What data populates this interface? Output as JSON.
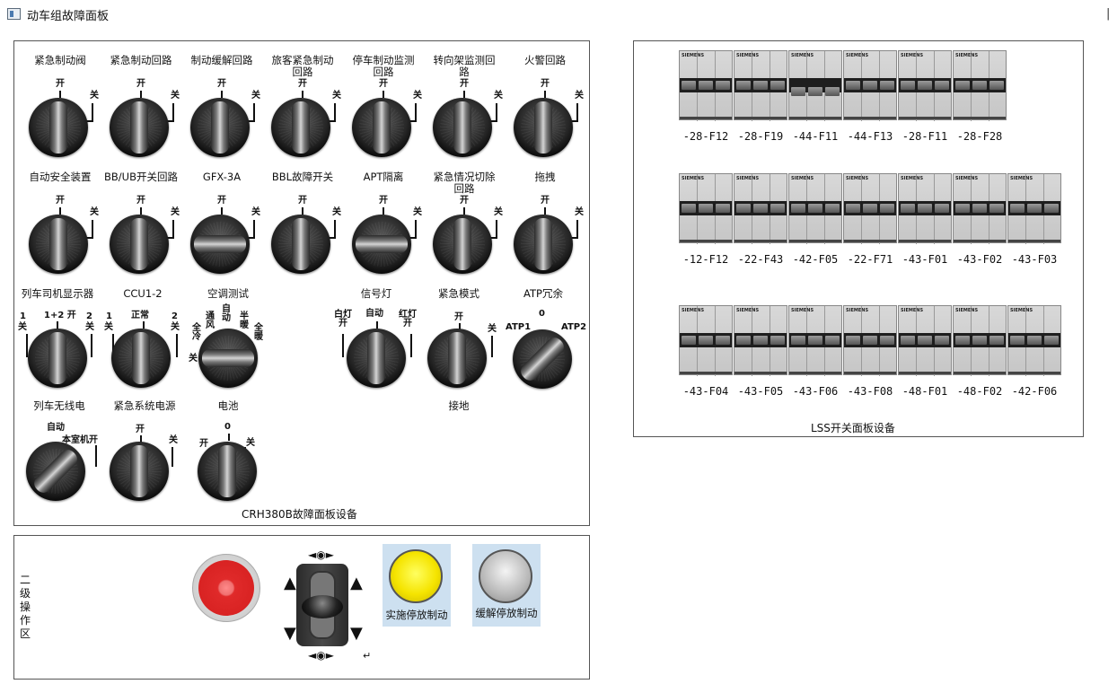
{
  "window": {
    "title": "动车组故障面板",
    "close_glyph": "|"
  },
  "crh_panel": {
    "caption": "CRH380B故障面板设备",
    "rows": [
      [
        {
          "label": "紧急制动阀",
          "open": "开",
          "close": "关"
        },
        {
          "label": "紧急制动回路",
          "open": "开",
          "close": "关"
        },
        {
          "label": "制动缓解回路",
          "open": "开",
          "close": "关"
        },
        {
          "label": "旅客紧急制动\n回路",
          "open": "开",
          "close": "关"
        },
        {
          "label": "停车制动监测\n回路",
          "open": "开",
          "close": "关"
        },
        {
          "label": "转向架监测回\n路",
          "open": "开",
          "close": "关"
        },
        {
          "label": "火警回路",
          "open": "开",
          "close": "关"
        }
      ],
      [
        {
          "label": "自动安全装置",
          "open": "开",
          "close": "关"
        },
        {
          "label": "BB/UB开关回路",
          "open": "开",
          "close": "关"
        },
        {
          "label": "GFX-3A",
          "open": "开",
          "close": "关"
        },
        {
          "label": "BBL故障开关",
          "open": "开",
          "close": "关"
        },
        {
          "label": "APT隔离",
          "open": "开",
          "close": "关"
        },
        {
          "label": "紧急情况切除\n回路",
          "open": "开",
          "close": "关"
        },
        {
          "label": "拖拽",
          "open": "开",
          "close": "关"
        }
      ]
    ],
    "row3": {
      "driver_display": {
        "label": "列车司机显示器",
        "pos1_num": "1",
        "pos1": "关",
        "pos2": "1+2 开",
        "pos3_num": "2",
        "pos3": "关"
      },
      "ccu": {
        "label": "CCU1-2",
        "pos1_num": "1",
        "pos1": "关",
        "pos2": "正常",
        "pos3_num": "2",
        "pos3": "关"
      },
      "ac_test": {
        "label": "空调测试",
        "off": "关",
        "full_cool": "全\n冷",
        "vent": "通\n风",
        "auto": "自\n动",
        "half_warm": "半\n暖",
        "full_warm": "全\n暖"
      },
      "signal_lamp": {
        "label": "信号灯",
        "white": "白灯\n开",
        "auto": "自动",
        "red": "红灯\n开"
      },
      "emergency_mode": {
        "label": "紧急模式",
        "open": "开",
        "close": "关",
        "ground": "接地"
      },
      "atp_redundancy": {
        "label": "ATP冗余",
        "atp1": "ATP1",
        "zero": "0",
        "atp2": "ATP2"
      }
    },
    "row4": {
      "train_radio": {
        "label": "列车无线电",
        "auto": "自动",
        "local": "本室机开"
      },
      "emergency_power": {
        "label": "紧急系统电源",
        "open": "开",
        "close": "关"
      },
      "battery": {
        "label": "电池",
        "open": "开",
        "zero": "0",
        "close": "关"
      }
    }
  },
  "lss_panel": {
    "caption": "LSS开关面板设备",
    "brand": "SIEMENS",
    "rows": [
      [
        "-28-F12",
        "-28-F19",
        "-44-F11",
        "-44-F13",
        "-28-F11",
        "-28-F28"
      ],
      [
        "-12-F12",
        "-22-F43",
        "-42-F05",
        "-22-F71",
        "-43-F01",
        "-43-F02",
        "-43-F03"
      ],
      [
        "-43-F04",
        "-43-F05",
        "-43-F06",
        "-43-F08",
        "-48-F01",
        "-48-F02",
        "-42-F06"
      ]
    ]
  },
  "op_panel": {
    "label": "二级操作区",
    "apply_brake": "实施停放制动",
    "release_brake": "缓解停放制动",
    "return_glyph": "↵"
  },
  "colors": {
    "estop_red": "#d41e1e",
    "apply_yellow": "#f5e400",
    "release_grey": "#b8b8b8",
    "button_bg": "#cde0f0"
  }
}
